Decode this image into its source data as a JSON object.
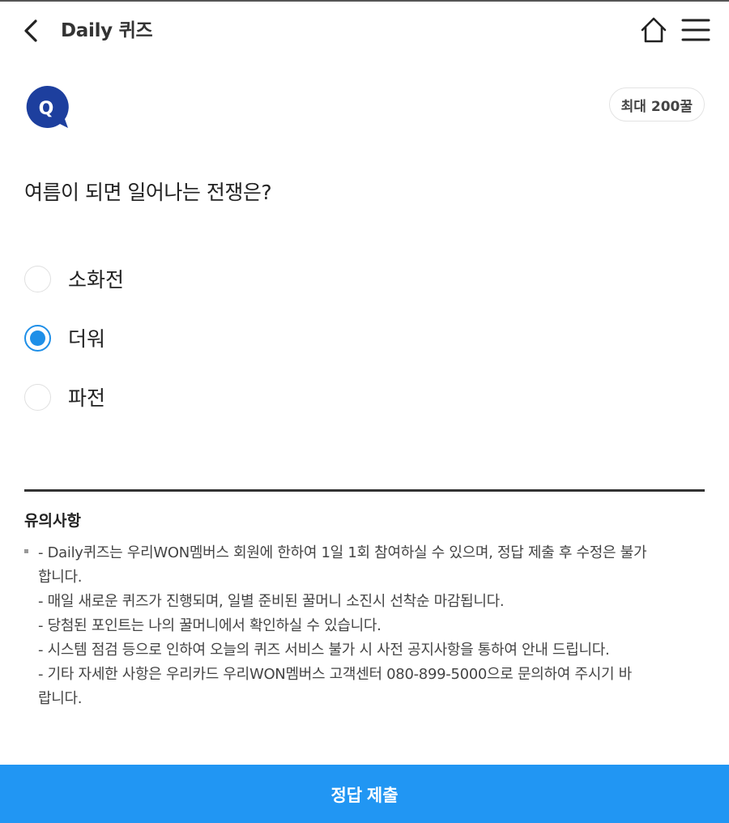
{
  "header": {
    "title": "Daily 퀴즈"
  },
  "quiz": {
    "badge_letter": "Q",
    "reward": "최대 200꿀",
    "question": "여름이 되면 일어나는 전쟁은?",
    "options": [
      {
        "label": "소화전",
        "selected": false
      },
      {
        "label": "더워",
        "selected": true
      },
      {
        "label": "파전",
        "selected": false
      }
    ]
  },
  "notice": {
    "title": "유의사항",
    "lines": [
      "- Daily퀴즈는 우리WON멤버스 회원에 한하여 1일 1회 참여하실 수 있으며, 정답 제출 후 수정은 불가",
      "합니다.",
      "- 매일 새로운 퀴즈가 진행되며, 일별 준비된 꿀머니 소진시 선착순 마감됩니다.",
      "- 당첨된 포인트는 나의 꿀머니에서 확인하실 수 있습니다.",
      "- 시스템 점검 등으로 인하여 오늘의 퀴즈 서비스 불가 시 사전 공지사항을 통하여 안내 드립니다.",
      "- 기타 자세한 사항은 우리카드 우리WON멤버스 고객센터 080-899-5000으로 문의하여 주시기 바",
      "랍니다."
    ]
  },
  "submit": {
    "label": "정답 제출"
  },
  "colors": {
    "accent": "#2196f3",
    "badge": "#1d3f9e",
    "radio_checked": "#1e8fe8"
  },
  "icons": [
    "chevron-left-icon",
    "home-icon",
    "hamburger-menu-icon",
    "q-speech-bubble-icon"
  ]
}
